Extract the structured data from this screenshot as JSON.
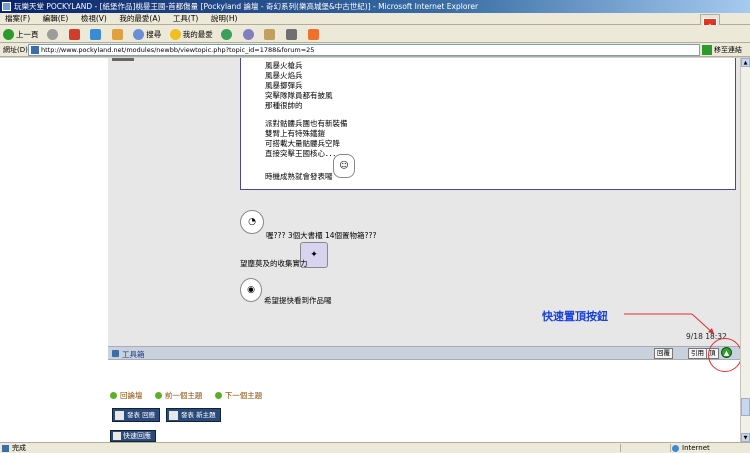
{
  "window": {
    "title": "玩樂天堂 POCKYLAND - [紙堡作品]桃曼王國-首都傷量 [Pockyland 論壇 - 奇幻系列(樂高城堡&中古世紀)] - Microsoft Internet Explorer"
  },
  "menu": [
    "檔案(F)",
    "編輯(E)",
    "檢視(V)",
    "我的最愛(A)",
    "工具(T)",
    "說明(H)"
  ],
  "toolbar": {
    "back": "上一頁",
    "search": "搜尋",
    "favorites": "我的最愛"
  },
  "address": {
    "label": "網址(D)",
    "url": "http://www.pockyland.net/modules/newbb/viewtopic.php?topic_id=1788&forum=25",
    "go": "移至",
    "links": "連結"
  },
  "post": {
    "quote_lines": [
      "風暴火槍兵",
      "風暴火焰兵",
      "風暴擲彈兵",
      "突擊隊隊員都有披風",
      "那種很帥的",
      "",
      "派對骷髏兵團也有新裝備",
      "雙臂上有特殊鐵鎧",
      "可搭載大量骷髏兵空降",
      "直接突擊王國核心．．．．",
      "",
      "",
      "時機成熟就會發表囉"
    ],
    "reply_line1": "喔??? 3個大書櫃 14個置物箱???",
    "reply_line2": "望塵莫及的收集實力",
    "reply_line3": "希望提快看到作品囉",
    "timestamp": "9/18 18:32"
  },
  "annotation": {
    "label": "快速置頂按鈕"
  },
  "post_toolbar": {
    "label": "工具箱",
    "buttons": [
      "回覆",
      "引用",
      "頂"
    ]
  },
  "nav": {
    "links": [
      "回論壇",
      "前一個主題",
      "下一個主題"
    ]
  },
  "post_buttons": {
    "reply": [
      "發表",
      "回應"
    ],
    "new_topic": [
      "發表",
      "新主題"
    ],
    "quick_reply": "快速回應"
  },
  "status": {
    "left": "完成",
    "zone": "Internet"
  }
}
